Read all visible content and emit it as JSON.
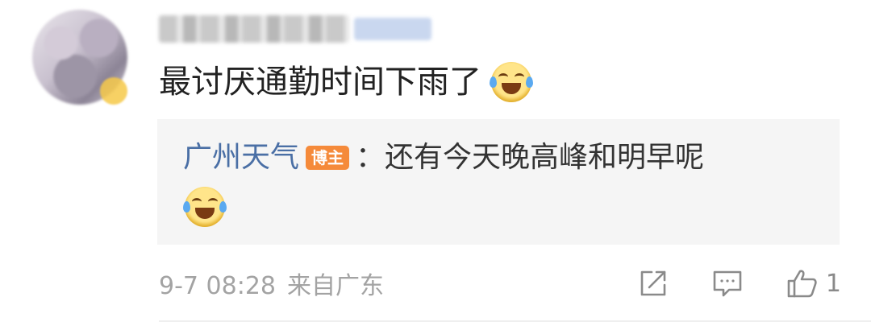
{
  "comment": {
    "content": "最讨厌通勤时间下雨了",
    "content_emoji": "laugh-cry-emoji"
  },
  "reply": {
    "author": "广州天气",
    "badge": "博主",
    "separator": "：",
    "text": "还有今天晚高峰和明早呢",
    "emoji": "laugh-cry-emoji"
  },
  "footer": {
    "timestamp": "9-7 08:28",
    "source": "来自广东",
    "like_count": "1"
  },
  "icons": {
    "share": "share-icon",
    "comment": "comment-icon",
    "like": "thumbs-up-icon"
  },
  "colors": {
    "author_link": "#4a6fa5",
    "badge_bg": "#f58a3a",
    "reply_bg": "#f5f5f5",
    "meta_text": "#a3a3a3"
  }
}
